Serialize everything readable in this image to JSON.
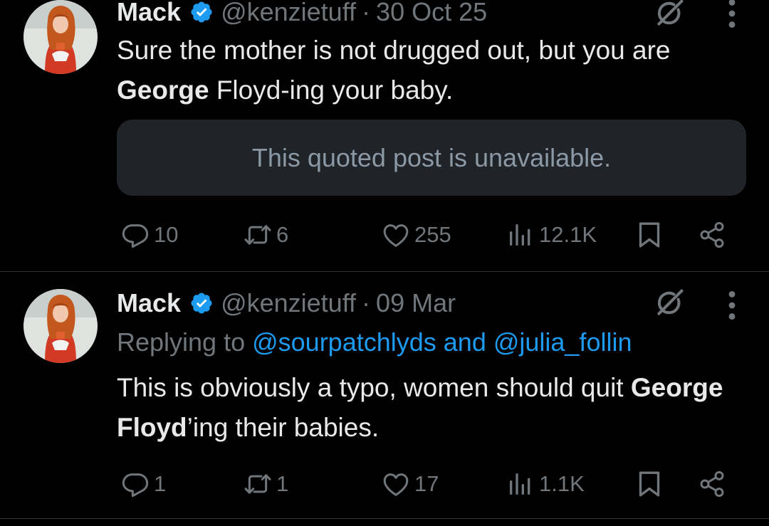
{
  "colors": {
    "background": "#000000",
    "text": "#e7e9ea",
    "muted": "#71767b",
    "accent": "#1d9bf0",
    "verified": "#1d9bf0",
    "quote_bg": "#202327"
  },
  "posts": [
    {
      "name": "Mack",
      "handle": "@kenzietuff",
      "dot": "·",
      "date": "30 Oct 25",
      "text_before": "Sure the mother is not drugged out, but you are ",
      "text_bold": "George",
      "text_after": " Floyd-ing your baby.",
      "quote_unavailable": "This quoted post is unavailable.",
      "replies": "10",
      "reposts": "6",
      "likes": "255",
      "views": "12.1K"
    },
    {
      "name": "Mack",
      "handle": "@kenzietuff",
      "dot": "·",
      "date": "09 Mar",
      "replying_prefix": "Replying to ",
      "replying_mentions": "@sourpatchlyds and @julia_follin",
      "text_before": "This is obviously a typo, women should quit ",
      "text_bold": "George Floyd",
      "text_after": "’ing their babies.",
      "replies": "1",
      "reposts": "1",
      "likes": "17",
      "views": "1.1K"
    }
  ],
  "icons": [
    "verified-badge-icon",
    "grok-icon",
    "more-icon",
    "reply-icon",
    "repost-icon",
    "like-icon",
    "views-icon",
    "bookmark-icon",
    "share-icon"
  ]
}
